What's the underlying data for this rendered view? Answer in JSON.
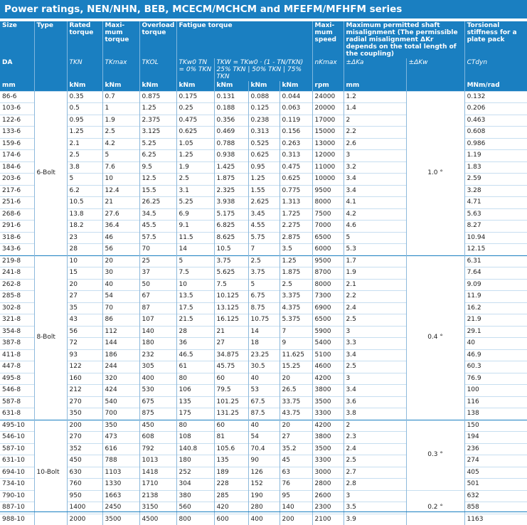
{
  "title": "Power ratings, NEN/NHN, BEB, MCECM/MCHCM and MFEFM/MFHFM series",
  "headers": {
    "size": "Size",
    "type": "Type",
    "rated": "Rated torque",
    "max": "Maxi-mum torque",
    "overload": "Overload torque",
    "fatigue": "Fatigue torque",
    "speed": "Maxi-mum speed",
    "misalign": "Maximum permitted shaft misalignment (The permissible radial misalignment ΔKr depends on the total length of the coupling)",
    "stiffness": "Torsional stiffness for a plate pack",
    "da": "DA",
    "tkn": "TKN",
    "tkmax": "TKmax",
    "tkol": "TKOL",
    "tkw0": "TKw0 TN = 0% TKN",
    "tkw_formula": "TKW = TKw0 · (1 - TN/TKN)",
    "p25": "25% TKN",
    "p50": "50% TKN",
    "p75": "75% TKN",
    "nkmax": "nKmax",
    "dka": "±ΔKa",
    "dkw": "±ΔKw",
    "ctdyn": "CTdyn",
    "u_mm": "mm",
    "u_knm1": "kNm",
    "u_knm2": "kNm",
    "u_knm3": "kNm",
    "u_knm4": "kNm",
    "u_knm5": "kNm",
    "u_knm6": "kNm",
    "u_knm7": "kNm",
    "u_rpm": "rpm",
    "u_mm2": "mm",
    "u_stiff": "MNm/rad"
  },
  "groups": [
    {
      "type": "6-Bolt",
      "rows": [
        [
          "86-6",
          "0.35",
          "0.7",
          "0.875",
          "0.175",
          "0.131",
          "0.088",
          "0.044",
          "24000",
          "1.2",
          "0.132"
        ],
        [
          "103-6",
          "0.5",
          "1",
          "1.25",
          "0.25",
          "0.188",
          "0.125",
          "0.063",
          "20000",
          "1.4",
          "0.206"
        ],
        [
          "122-6",
          "0.95",
          "1.9",
          "2.375",
          "0.475",
          "0.356",
          "0.238",
          "0.119",
          "17000",
          "2",
          "0.463"
        ],
        [
          "133-6",
          "1.25",
          "2.5",
          "3.125",
          "0.625",
          "0.469",
          "0.313",
          "0.156",
          "15000",
          "2.2",
          "0.608"
        ],
        [
          "159-6",
          "2.1",
          "4.2",
          "5.25",
          "1.05",
          "0.788",
          "0.525",
          "0.263",
          "13000",
          "2.6",
          "0.986"
        ],
        [
          "174-6",
          "2.5",
          "5",
          "6.25",
          "1.25",
          "0.938",
          "0.625",
          "0.313",
          "12000",
          "3",
          "1.19"
        ],
        [
          "184-6",
          "3.8",
          "7.6",
          "9.5",
          "1.9",
          "1.425",
          "0.95",
          "0.475",
          "11000",
          "3.2",
          "1.83"
        ],
        [
          "203-6",
          "5",
          "10",
          "12.5",
          "2.5",
          "1.875",
          "1.25",
          "0.625",
          "10000",
          "3.4",
          "2.59"
        ],
        [
          "217-6",
          "6.2",
          "12.4",
          "15.5",
          "3.1",
          "2.325",
          "1.55",
          "0.775",
          "9500",
          "3.4",
          "3.28"
        ],
        [
          "251-6",
          "10.5",
          "21",
          "26.25",
          "5.25",
          "3.938",
          "2.625",
          "1.313",
          "8000",
          "4.1",
          "4.71"
        ],
        [
          "268-6",
          "13.8",
          "27.6",
          "34.5",
          "6.9",
          "5.175",
          "3.45",
          "1.725",
          "7500",
          "4.2",
          "5.63"
        ],
        [
          "291-6",
          "18.2",
          "36.4",
          "45.5",
          "9.1",
          "6.825",
          "4.55",
          "2.275",
          "7000",
          "4.6",
          "8.27"
        ],
        [
          "318-6",
          "23",
          "46",
          "57.5",
          "11.5",
          "8.625",
          "5.75",
          "2.875",
          "6500",
          "5",
          "10.94"
        ],
        [
          "343-6",
          "28",
          "56",
          "70",
          "14",
          "10.5",
          "7",
          "3.5",
          "6000",
          "5.3",
          "12.15"
        ]
      ]
    },
    {
      "type": "8-Bolt",
      "rows": [
        [
          "219-8",
          "10",
          "20",
          "25",
          "5",
          "3.75",
          "2.5",
          "1.25",
          "9500",
          "1.7",
          "6.31"
        ],
        [
          "241-8",
          "15",
          "30",
          "37",
          "7.5",
          "5.625",
          "3.75",
          "1.875",
          "8700",
          "1.9",
          "7.64"
        ],
        [
          "262-8",
          "20",
          "40",
          "50",
          "10",
          "7.5",
          "5",
          "2.5",
          "8000",
          "2.1",
          "9.09"
        ],
        [
          "285-8",
          "27",
          "54",
          "67",
          "13.5",
          "10.125",
          "6.75",
          "3.375",
          "7300",
          "2.2",
          "11.9"
        ],
        [
          "302-8",
          "35",
          "70",
          "87",
          "17.5",
          "13.125",
          "8.75",
          "4.375",
          "6900",
          "2.4",
          "16.2"
        ],
        [
          "321-8",
          "43",
          "86",
          "107",
          "21.5",
          "16.125",
          "10.75",
          "5.375",
          "6500",
          "2.5",
          "21.9"
        ],
        [
          "354-8",
          "56",
          "112",
          "140",
          "28",
          "21",
          "14",
          "7",
          "5900",
          "3",
          "29.1"
        ],
        [
          "387-8",
          "72",
          "144",
          "180",
          "36",
          "27",
          "18",
          "9",
          "5400",
          "3.3",
          "40"
        ],
        [
          "411-8",
          "93",
          "186",
          "232",
          "46.5",
          "34.875",
          "23.25",
          "11.625",
          "5100",
          "3.4",
          "46.9"
        ],
        [
          "447-8",
          "122",
          "244",
          "305",
          "61",
          "45.75",
          "30.5",
          "15.25",
          "4600",
          "2.5",
          "60.3"
        ],
        [
          "495-8",
          "160",
          "320",
          "400",
          "80",
          "60",
          "40",
          "20",
          "4200",
          "3",
          "76.9"
        ],
        [
          "546-8",
          "212",
          "424",
          "530",
          "106",
          "79.5",
          "53",
          "26.5",
          "3800",
          "3.4",
          "100"
        ],
        [
          "587-8",
          "270",
          "540",
          "675",
          "135",
          "101.25",
          "67.5",
          "33.75",
          "3500",
          "3.6",
          "116"
        ],
        [
          "631-8",
          "350",
          "700",
          "875",
          "175",
          "131.25",
          "87.5",
          "43.75",
          "3300",
          "3.8",
          "138"
        ]
      ]
    },
    {
      "type": "10-Bolt",
      "rows": [
        [
          "495-10",
          "200",
          "350",
          "450",
          "80",
          "60",
          "40",
          "20",
          "4200",
          "2",
          "150"
        ],
        [
          "546-10",
          "270",
          "473",
          "608",
          "108",
          "81",
          "54",
          "27",
          "3800",
          "2.3",
          "194"
        ],
        [
          "587-10",
          "352",
          "616",
          "792",
          "140.8",
          "105.6",
          "70.4",
          "35.2",
          "3500",
          "2.4",
          "236"
        ],
        [
          "631-10",
          "450",
          "788",
          "1013",
          "180",
          "135",
          "90",
          "45",
          "3300",
          "2.5",
          "274"
        ],
        [
          "694-10",
          "630",
          "1103",
          "1418",
          "252",
          "189",
          "126",
          "63",
          "3000",
          "2.7",
          "405"
        ],
        [
          "734-10",
          "760",
          "1330",
          "1710",
          "304",
          "228",
          "152",
          "76",
          "2800",
          "2.8",
          "501"
        ],
        [
          "790-10",
          "950",
          "1663",
          "2138",
          "380",
          "285",
          "190",
          "95",
          "2600",
          "3",
          "632"
        ],
        [
          "887-10",
          "1400",
          "2450",
          "3150",
          "560",
          "420",
          "280",
          "140",
          "2300",
          "3.5",
          "858"
        ],
        [
          "988-10",
          "2000",
          "3500",
          "4500",
          "800",
          "600",
          "400",
          "200",
          "2100",
          "3.9",
          "1163"
        ]
      ]
    }
  ],
  "kw_values": [
    {
      "value": "1.0 °"
    },
    {
      "value": "0.4 °"
    },
    {
      "value": "0.3 °"
    },
    {
      "value": "0.2 °"
    }
  ]
}
